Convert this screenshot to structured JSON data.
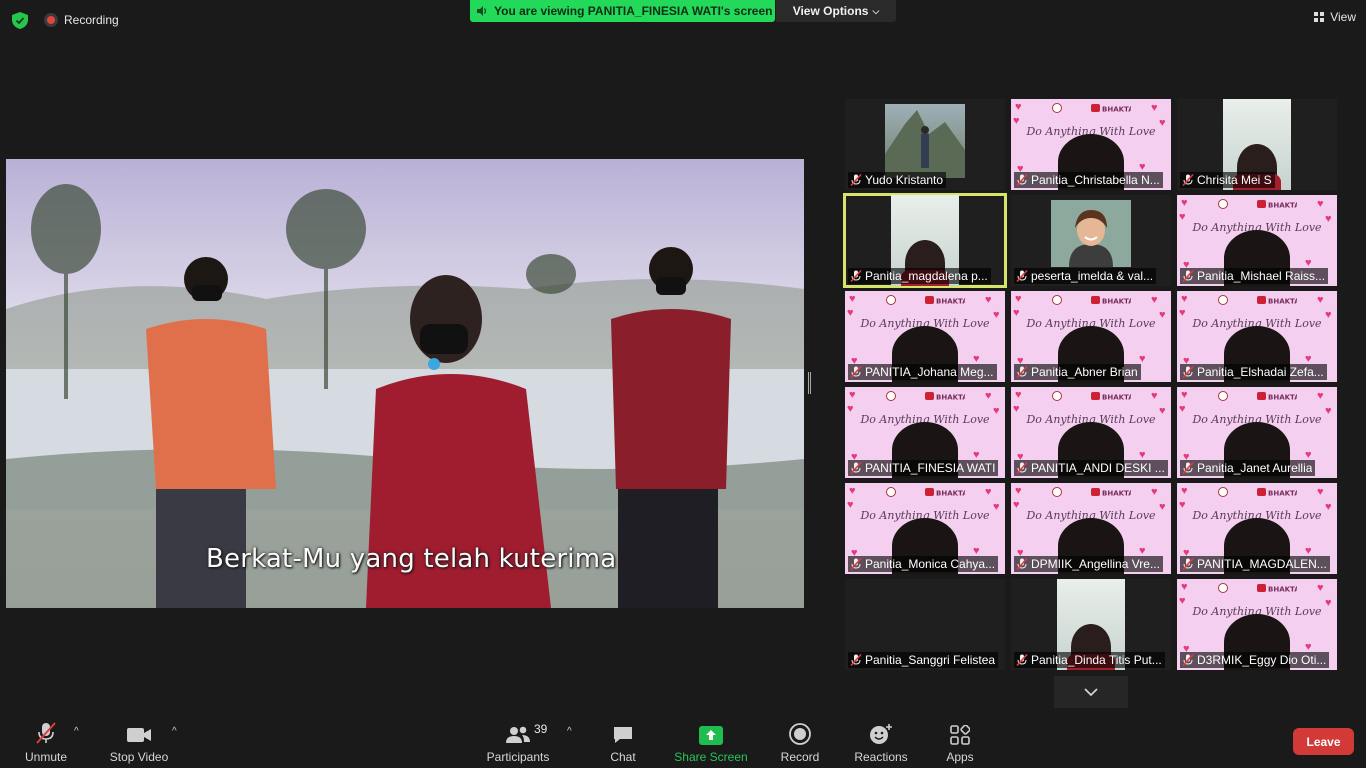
{
  "top": {
    "recording_label": "Recording",
    "banner_text": "You are viewing PANITIA_FINESIA WATI's screen",
    "view_options_label": "View Options",
    "view_label": "View"
  },
  "shared_screen": {
    "caption": "Berkat-Mu yang telah kuterima"
  },
  "gallery": [
    {
      "name": "Yudo Kristanto",
      "type": "photo"
    },
    {
      "name": "Panitia_Christabella N...",
      "type": "poster"
    },
    {
      "name": "Chrisita Mei S",
      "type": "camera"
    },
    {
      "name": "Panitia_magdalena p...",
      "type": "camera",
      "active": true
    },
    {
      "name": "peserta_imelda & val...",
      "type": "avatar"
    },
    {
      "name": "Panitia_Mishael Raiss...",
      "type": "poster"
    },
    {
      "name": "PANITIA_Johana Meg...",
      "type": "poster"
    },
    {
      "name": "Panitia_Abner Brian",
      "type": "poster"
    },
    {
      "name": "Panitia_Elshadai Zefa...",
      "type": "poster"
    },
    {
      "name": "PANITIA_FINESIA WATI",
      "type": "poster"
    },
    {
      "name": "PANITIA_ANDI DESKI ...",
      "type": "poster"
    },
    {
      "name": "Panitia_Janet Aurellia",
      "type": "poster"
    },
    {
      "name": "Panitia_Monica Cahya...",
      "type": "poster"
    },
    {
      "name": "DPMIIK_Angellina Vre...",
      "type": "poster"
    },
    {
      "name": "PANITIA_MAGDALEN...",
      "type": "poster"
    },
    {
      "name": "Panitia_Sanggri Felistea",
      "type": "blank"
    },
    {
      "name": "Panitia_Dinda Titis Put...",
      "type": "camera"
    },
    {
      "name": "D3RMIK_Eggy Dio Oti...",
      "type": "poster"
    }
  ],
  "poster_script": "Do Anything With Love",
  "poster_logo_text": "BHAKTA",
  "toolbar": {
    "unmute": "Unmute",
    "stop_video": "Stop Video",
    "participants": "Participants",
    "participants_count": "39",
    "chat": "Chat",
    "share_screen": "Share Screen",
    "record": "Record",
    "reactions": "Reactions",
    "apps": "Apps",
    "leave": "Leave"
  },
  "colors": {
    "banner_green": "#23d959",
    "leave_red": "#d13a37",
    "active_speaker": "#d6e56a",
    "share_green": "#1fbd4e"
  }
}
